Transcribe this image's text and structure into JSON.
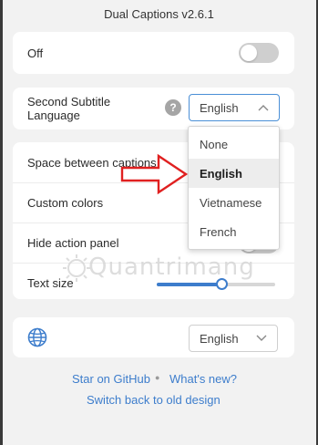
{
  "app": {
    "title": "Dual Captions v2.6.1"
  },
  "off_card": {
    "label": "Off",
    "toggle_state": "off"
  },
  "second_subtitle": {
    "label_line1": "Second Subtitle",
    "label_line2": "Language",
    "help_glyph": "?",
    "selected": "English",
    "options": [
      "None",
      "English",
      "Vietnamese",
      "French"
    ],
    "highlighted_option": "English"
  },
  "settings": {
    "space_between_captions": "Space between captions",
    "custom_colors": "Custom colors",
    "hide_action_panel": "Hide action panel",
    "text_size": "Text size",
    "text_size_level": 0.55
  },
  "language_card": {
    "icon": "globe-icon",
    "selected": "English"
  },
  "footer": {
    "star_link": "Star on GitHub",
    "separator": "●",
    "whats_new_link": "What's new?",
    "switch_link": "Switch back to old design"
  },
  "watermark": {
    "text": "Quantrimang"
  },
  "colors": {
    "accent": "#3d7dcc",
    "arrow_red": "#e02020",
    "toggle_off": "#cfcfcf",
    "background": "#f2f2f2"
  }
}
